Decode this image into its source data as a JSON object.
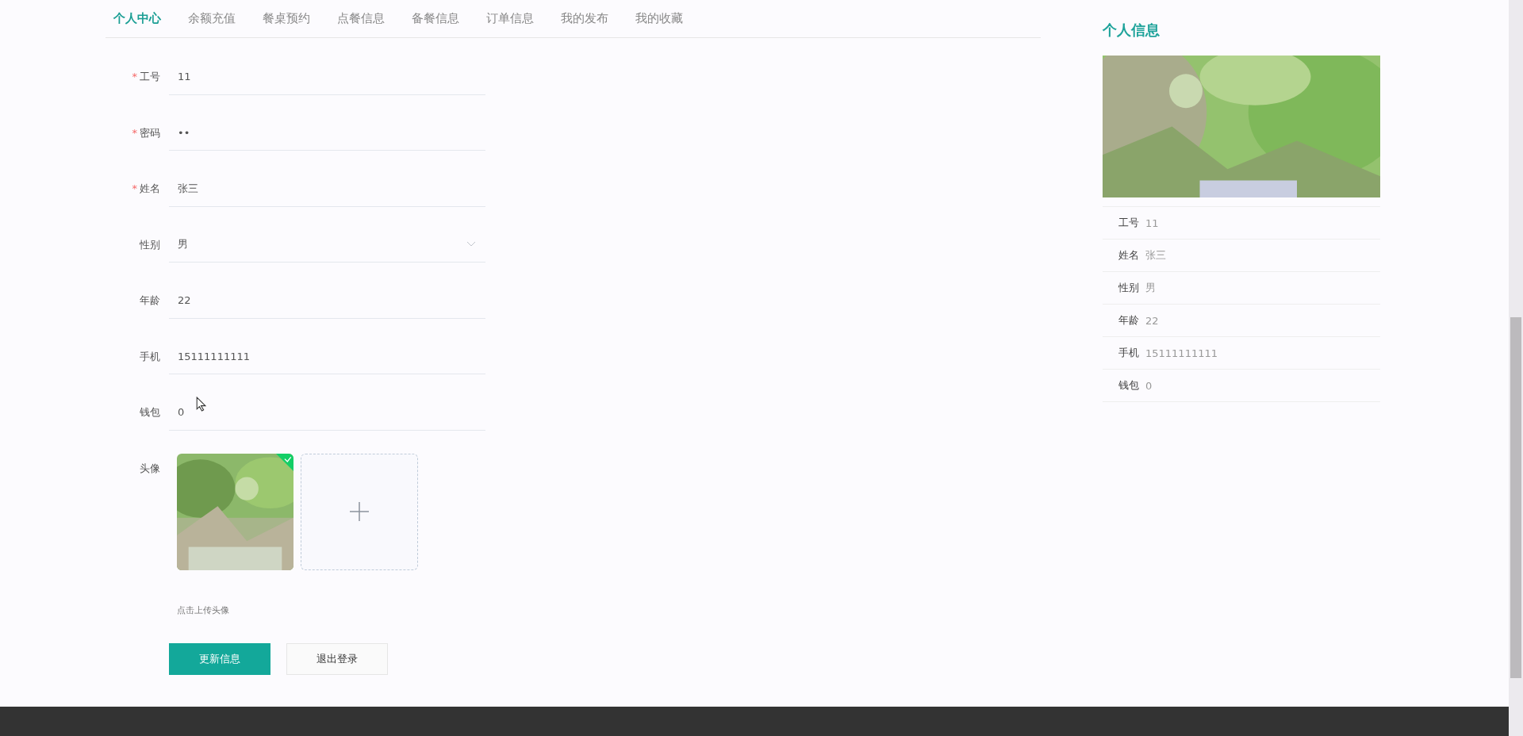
{
  "nav": {
    "tabs": [
      {
        "label": "个人中心",
        "selected": true
      },
      {
        "label": "余额充值",
        "selected": false
      },
      {
        "label": "餐桌预约",
        "selected": false
      },
      {
        "label": "点餐信息",
        "selected": false
      },
      {
        "label": "备餐信息",
        "selected": false
      },
      {
        "label": "订单信息",
        "selected": false
      },
      {
        "label": "我的发布",
        "selected": false
      },
      {
        "label": "我的收藏",
        "selected": false
      }
    ]
  },
  "form": {
    "required_mark": "*",
    "fields": [
      {
        "label": "工号",
        "required": true,
        "kind": "text",
        "value": "11"
      },
      {
        "label": "密码",
        "required": true,
        "kind": "text",
        "value": "••"
      },
      {
        "label": "姓名",
        "required": true,
        "kind": "text",
        "value": "张三"
      },
      {
        "label": "性别",
        "required": false,
        "kind": "select",
        "value": "男"
      },
      {
        "label": "年龄",
        "required": false,
        "kind": "text",
        "value": "22"
      },
      {
        "label": "手机",
        "required": false,
        "kind": "text",
        "value": "15111111111"
      },
      {
        "label": "钱包",
        "required": false,
        "kind": "text",
        "value": "0"
      }
    ],
    "avatar": {
      "label": "头像",
      "uploaded": true,
      "hint": "点击上传头像"
    },
    "buttons": [
      {
        "label": "更新信息",
        "kind": "primary"
      },
      {
        "label": "退出登录",
        "kind": "plain"
      }
    ]
  },
  "profile": {
    "title": "个人信息",
    "rows": [
      {
        "label": "工号",
        "value": "11"
      },
      {
        "label": "姓名",
        "value": "张三"
      },
      {
        "label": "性别",
        "value": "男"
      },
      {
        "label": "年龄",
        "value": "22"
      },
      {
        "label": "手机",
        "value": "15111111111"
      },
      {
        "label": "钱包",
        "value": "0"
      }
    ]
  }
}
